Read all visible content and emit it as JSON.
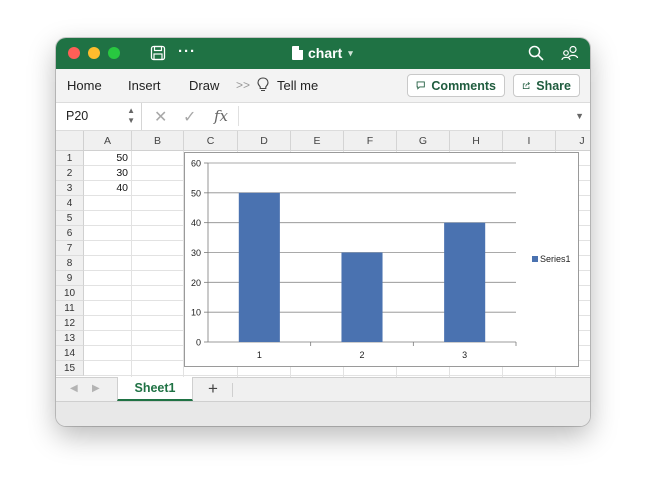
{
  "window": {
    "title": "chart"
  },
  "ribbon": {
    "tabs": [
      "Home",
      "Insert",
      "Draw"
    ],
    "overflow": ">>",
    "tell_me": "Tell me",
    "comments_label": "Comments",
    "share_label": "Share"
  },
  "formula_bar": {
    "name_box": "P20",
    "fx": "fx",
    "formula": ""
  },
  "grid": {
    "columns": [
      "A",
      "B",
      "C",
      "D",
      "E",
      "F",
      "G",
      "H",
      "I",
      "J"
    ],
    "rows": [
      "1",
      "2",
      "3",
      "4",
      "5",
      "6",
      "7",
      "8",
      "9",
      "10",
      "11",
      "12",
      "13",
      "14",
      "15"
    ],
    "cells": [
      {
        "ref": "A1",
        "value": "50"
      },
      {
        "ref": "A2",
        "value": "30"
      },
      {
        "ref": "A3",
        "value": "40"
      }
    ]
  },
  "sheets": {
    "active": "Sheet1",
    "add_label": "+"
  },
  "colors": {
    "accent": "#1f7244",
    "series1": "#4a72b0"
  },
  "chart_data": {
    "type": "bar",
    "categories": [
      "1",
      "2",
      "3"
    ],
    "series": [
      {
        "name": "Series1",
        "values": [
          50,
          30,
          40
        ]
      }
    ],
    "ylim": [
      0,
      60
    ],
    "yticks": [
      0,
      10,
      20,
      30,
      40,
      50,
      60
    ],
    "grid": true,
    "legend": "right"
  }
}
